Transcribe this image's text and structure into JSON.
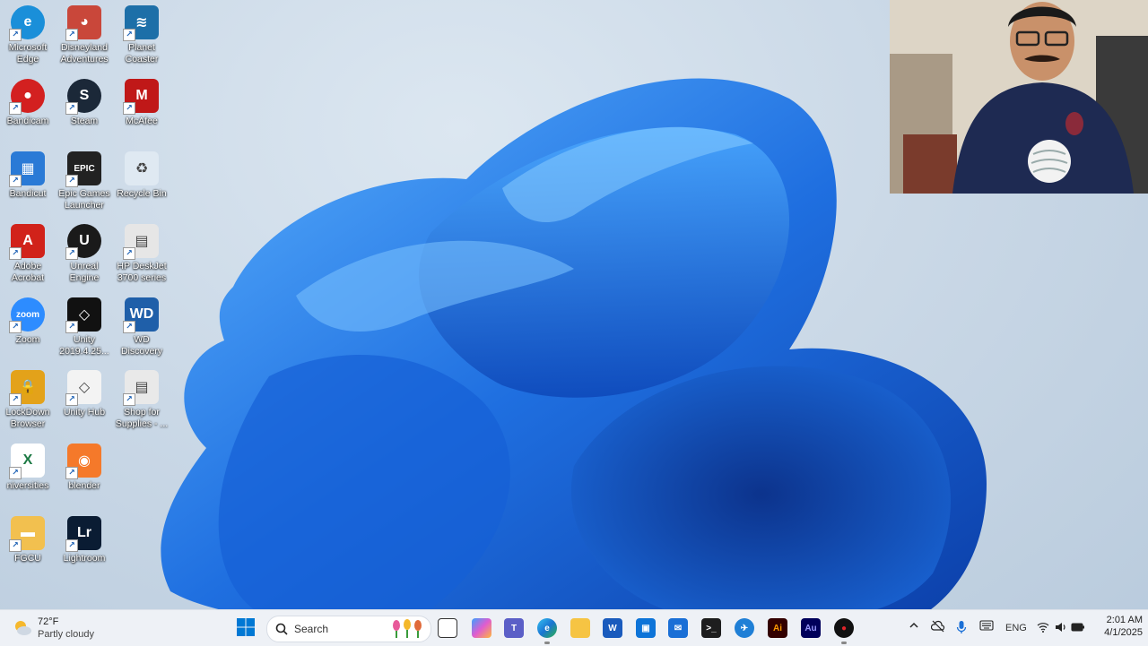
{
  "desktop": {
    "icons": [
      {
        "label1": "Microsoft",
        "label2": "Edge",
        "icon": "edge-icon",
        "color": "#1a8fd9"
      },
      {
        "label1": "Disneyland",
        "label2": "Adventures",
        "icon": "disneyland-icon",
        "color": "#c9473a"
      },
      {
        "label1": "Planet",
        "label2": "Coaster",
        "icon": "planet-coaster-icon",
        "color": "#1d6fa8"
      },
      {
        "label1": "Bandicam",
        "label2": "",
        "icon": "bandicam-icon",
        "color": "#d32020"
      },
      {
        "label1": "Steam",
        "label2": "",
        "icon": "steam-icon",
        "color": "#1b2838"
      },
      {
        "label1": "McAfee",
        "label2": "",
        "icon": "mcafee-icon",
        "color": "#c01818"
      },
      {
        "label1": "Bandicut",
        "label2": "",
        "icon": "bandicut-icon",
        "color": "#2a7ad6"
      },
      {
        "label1": "Epic Games",
        "label2": "Launcher",
        "icon": "epic-games-icon",
        "color": "#222222"
      },
      {
        "label1": "Recycle Bin",
        "label2": "",
        "icon": "recycle-bin-icon",
        "color": "#dfe9f2"
      },
      {
        "label1": "Adobe",
        "label2": "Acrobat",
        "icon": "adobe-acrobat-icon",
        "color": "#d1221a"
      },
      {
        "label1": "Unreal",
        "label2": "Engine",
        "icon": "unreal-engine-icon",
        "color": "#1a1a1a"
      },
      {
        "label1": "HP DeskJet",
        "label2": "3700 series",
        "icon": "printer-icon",
        "color": "#e6e6e6"
      },
      {
        "label1": "Zoom",
        "label2": "",
        "icon": "zoom-icon",
        "color": "#2d8cff"
      },
      {
        "label1": "Unity",
        "label2": "2019.4.25...",
        "icon": "unity-icon",
        "color": "#111111"
      },
      {
        "label1": "WD",
        "label2": "Discovery",
        "icon": "wd-discovery-icon",
        "color": "#1f5fa9"
      },
      {
        "label1": "LockDown",
        "label2": "Browser",
        "icon": "lockdown-browser-icon",
        "color": "#e3a21a"
      },
      {
        "label1": "Unity Hub",
        "label2": "",
        "icon": "unity-hub-icon",
        "color": "#f3f3f3"
      },
      {
        "label1": "Shop for",
        "label2": "Supplies - ...",
        "icon": "shop-supplies-icon",
        "color": "#e9e9e9"
      },
      {
        "label1": "niversities",
        "label2": "",
        "icon": "excel-icon",
        "color": "#ffffff"
      },
      {
        "label1": "blender",
        "label2": "",
        "icon": "blender-icon",
        "color": "#f5792a"
      },
      {
        "label1": "FGCU",
        "label2": "",
        "icon": "folder-icon",
        "color": "#f2c04f"
      },
      {
        "label1": "Lightroom",
        "label2": "",
        "icon": "lightroom-icon",
        "color": "#0a1c33"
      }
    ],
    "glyphs": {
      "edge": "e",
      "steam": "S",
      "mcafee": "M",
      "epic": "EPIC",
      "adobe": "A",
      "unreal": "U",
      "zoom": "zoom",
      "unity": "◇",
      "wd": "WD",
      "excel": "X",
      "lightroom": "Lr",
      "recycle": "♻",
      "bandicam": "●",
      "bandicut": "▦",
      "blender": "◉",
      "folder": "▬",
      "printer": "▤",
      "lock": "🔒",
      "disney": "◕",
      "planet": "≋",
      "shop": "▤",
      "unityhub": "◇"
    }
  },
  "taskbar": {
    "weather": {
      "temp": "72°F",
      "condition": "Partly cloudy",
      "icon": "partly-cloudy-icon"
    },
    "search_placeholder": "Search",
    "apps": [
      "task-view-icon",
      "copilot-icon",
      "teams-icon",
      "edge-icon",
      "file-explorer-icon",
      "word-icon",
      "microsoft-store-icon",
      "mail-icon",
      "terminal-icon",
      "app-icon",
      "illustrator-icon",
      "audition-icon",
      "recorder-icon"
    ],
    "app_labels": {
      "word": "W",
      "illustrator": "Ai",
      "audition": "Au"
    },
    "tray": {
      "language": "ENG",
      "time": "2:01 AM",
      "date": "4/1/2025"
    }
  },
  "colors": {
    "taskbar_bg": "#eef1f6",
    "wallpaper_bloom": "#1f6fe0",
    "accent": "#0067c0"
  }
}
